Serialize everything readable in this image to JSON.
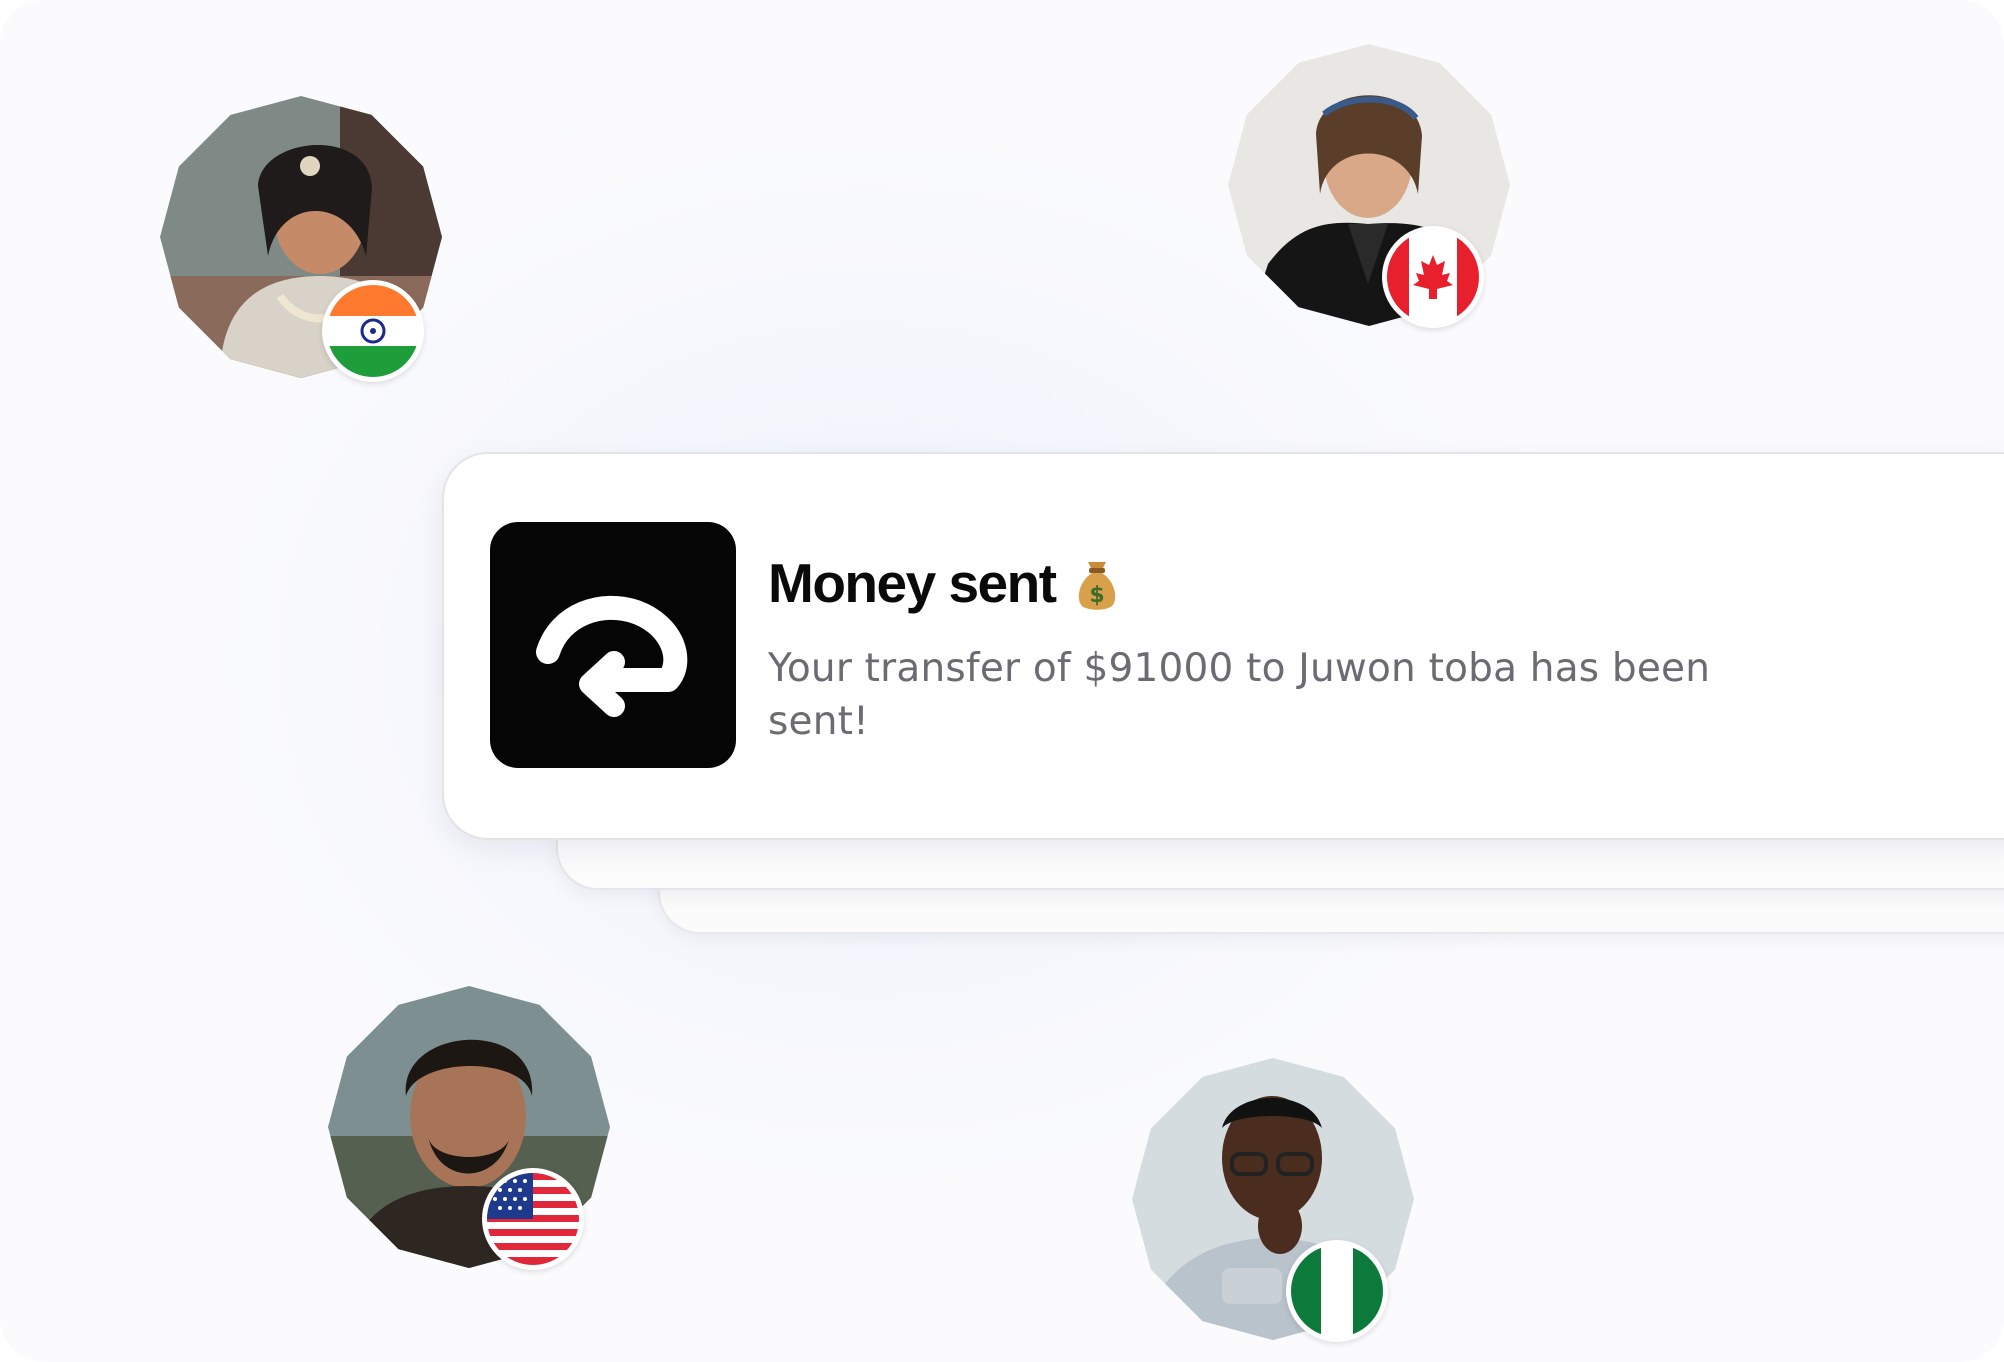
{
  "notification": {
    "title": "Money sent",
    "title_emoji": "money-bag-icon",
    "message": "Your transfer of $91000 to Juwon toba has been sent!",
    "app_icon": "send-arrow-icon"
  },
  "avatars": [
    {
      "name": "avatar-india",
      "flag": "flag-india-icon"
    },
    {
      "name": "avatar-canada",
      "flag": "flag-canada-icon"
    },
    {
      "name": "avatar-usa",
      "flag": "flag-usa-icon"
    },
    {
      "name": "avatar-nigeria",
      "flag": "flag-nigeria-icon"
    }
  ],
  "colors": {
    "icon_bg": "#050505",
    "title": "#0a0a0a",
    "message": "#6b6b72",
    "india_saffron": "#FF7A2F",
    "india_green": "#1E9E3A",
    "india_chakra": "#1B2A8C",
    "canada_red": "#E8202E",
    "nigeria_green": "#0B7A3B",
    "usa_red": "#E0283A",
    "usa_blue": "#1E3A8C"
  }
}
